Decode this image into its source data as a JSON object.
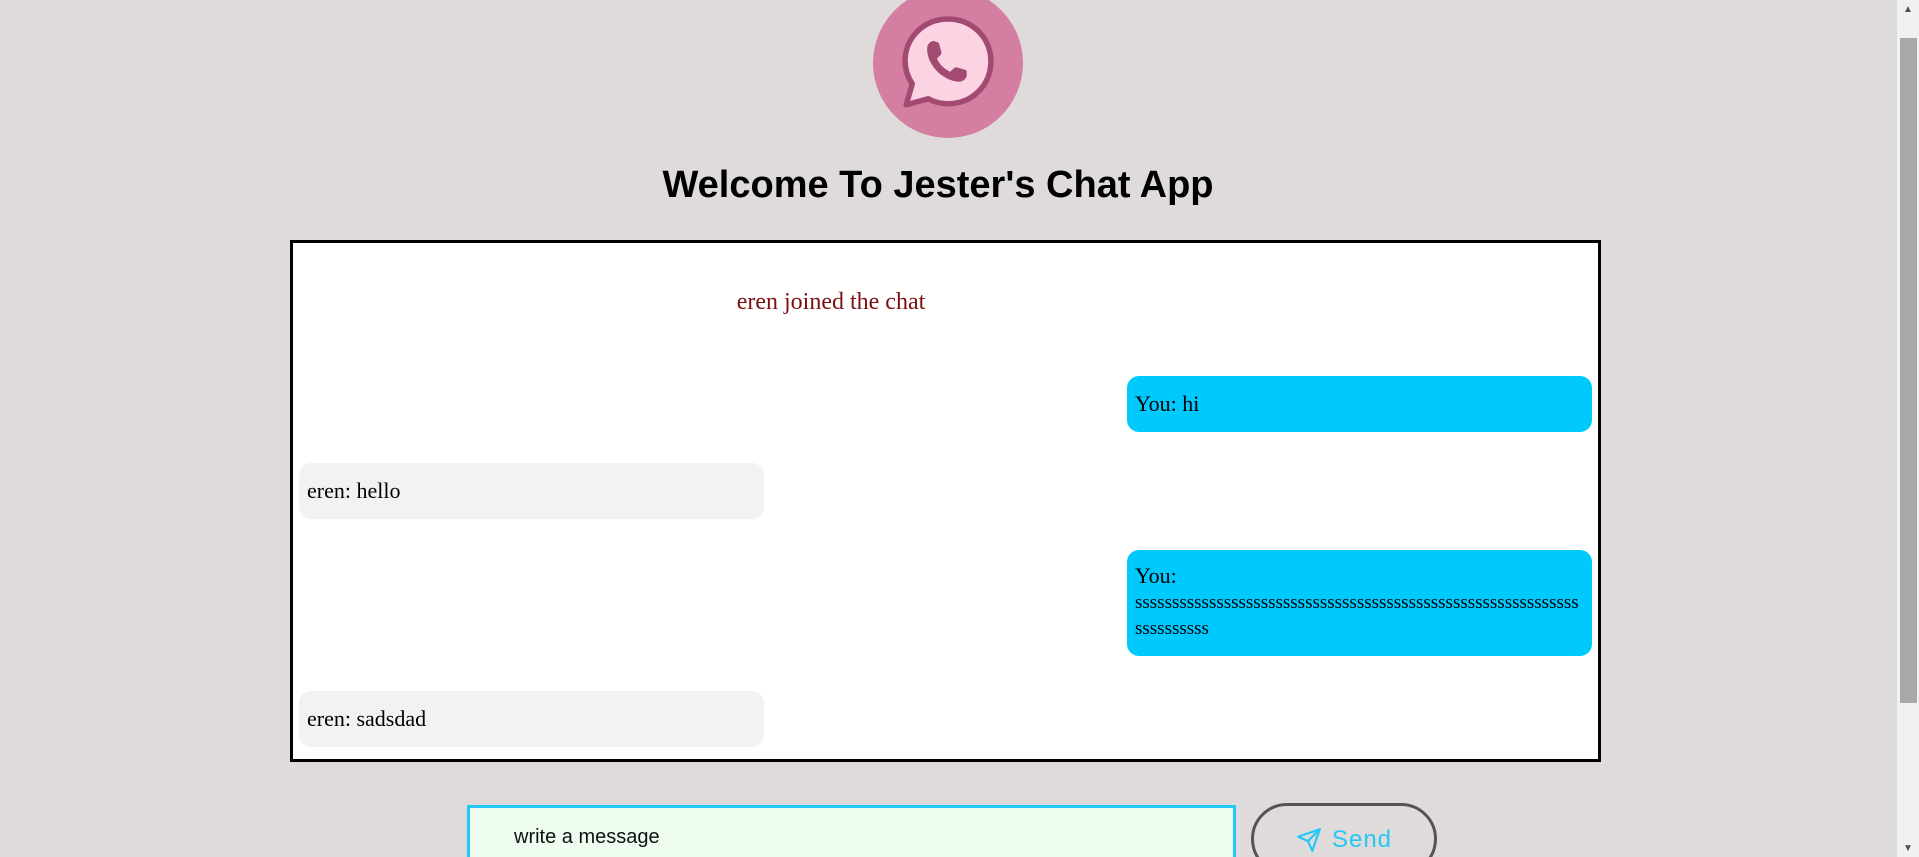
{
  "header": {
    "title": "Welcome To Jester's Chat App",
    "logo_icon": "whatsapp-phone-icon",
    "logo_color": "#d47fa1"
  },
  "chat": {
    "system_message": "eren joined the chat",
    "messages": [
      {
        "sender": "You",
        "direction": "out",
        "label": "You: hi"
      },
      {
        "sender": "eren",
        "direction": "in",
        "label": "eren: hello"
      },
      {
        "sender": "You",
        "direction": "out",
        "label": "You:",
        "body": "ssssssssssssssssssssssssssssssssssssssssssssssssssssssssssssssssssssss"
      },
      {
        "sender": "eren",
        "direction": "in",
        "label": "eren: sadsdad"
      }
    ],
    "outgoing_color": "#00c9fd",
    "incoming_color": "#f4f2f1"
  },
  "composer": {
    "placeholder": "write a message",
    "value": "",
    "send_label": "Send",
    "send_icon": "paper-plane-icon",
    "accent_color": "#24c8f4"
  }
}
